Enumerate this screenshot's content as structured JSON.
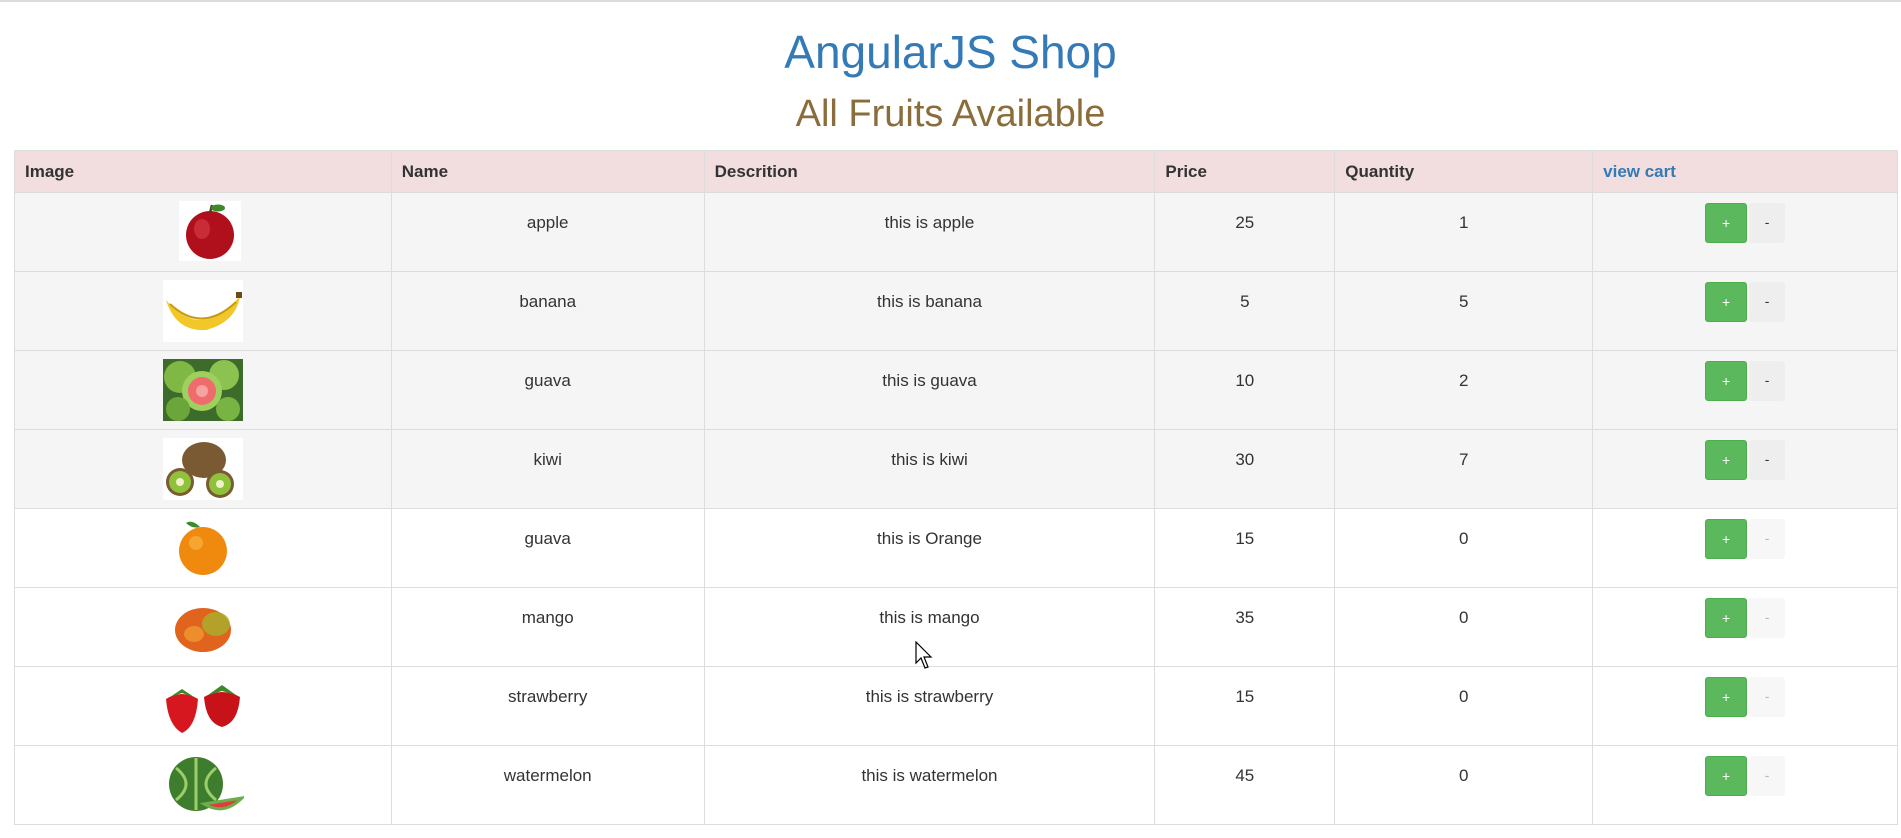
{
  "page": {
    "title": "AngularJS Shop",
    "subtitle": "All Fruits Available"
  },
  "table": {
    "headers": {
      "image": "Image",
      "name": "Name",
      "description": "Descrition",
      "price": "Price",
      "quantity": "Quantity",
      "view_cart": "view cart"
    },
    "rows": [
      {
        "icon": "apple-image",
        "name": "apple",
        "description": "this is apple",
        "price": "25",
        "quantity": "1",
        "minus_enabled": true
      },
      {
        "icon": "banana-image",
        "name": "banana",
        "description": "this is banana",
        "price": "5",
        "quantity": "5",
        "minus_enabled": true
      },
      {
        "icon": "guava-image",
        "name": "guava",
        "description": "this is guava",
        "price": "10",
        "quantity": "2",
        "minus_enabled": true
      },
      {
        "icon": "kiwi-image",
        "name": "kiwi",
        "description": "this is kiwi",
        "price": "30",
        "quantity": "7",
        "minus_enabled": true
      },
      {
        "icon": "orange-image",
        "name": "guava",
        "description": "this is Orange",
        "price": "15",
        "quantity": "0",
        "minus_enabled": false
      },
      {
        "icon": "mango-image",
        "name": "mango",
        "description": "this is mango",
        "price": "35",
        "quantity": "0",
        "minus_enabled": false
      },
      {
        "icon": "strawberry-image",
        "name": "strawberry",
        "description": "this is strawberry",
        "price": "15",
        "quantity": "0",
        "minus_enabled": false
      },
      {
        "icon": "watermelon-image",
        "name": "watermelon",
        "description": "this is watermelon",
        "price": "45",
        "quantity": "0",
        "minus_enabled": false
      }
    ],
    "plus_label": "+",
    "minus_label": "-"
  },
  "colors": {
    "title": "#337ab7",
    "subtitle": "#8a6d3b",
    "header_bg": "#f2dede",
    "plus_button": "#5cb85c"
  }
}
